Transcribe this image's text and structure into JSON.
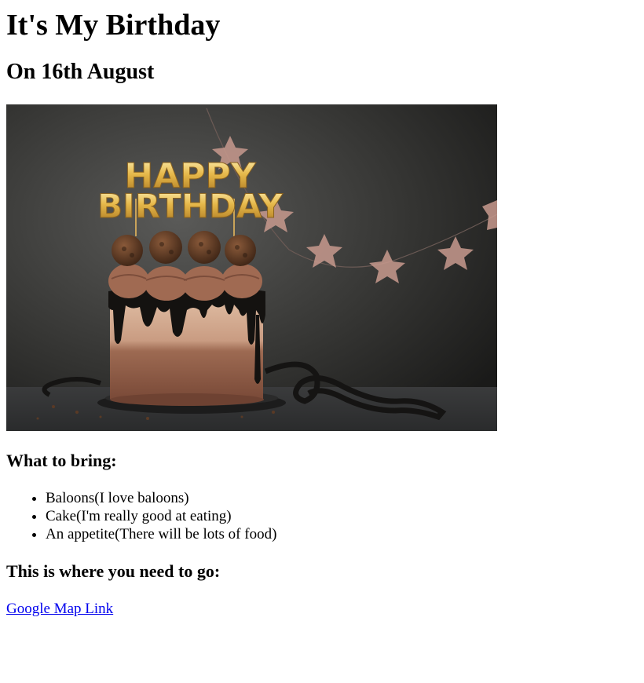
{
  "page": {
    "title": "It's My Birthday",
    "subtitle": "On 16th August"
  },
  "image": {
    "description_icon": "birthday-cake-photo",
    "topper_line1": "HAPPY",
    "topper_line2": "BIRTHDAY"
  },
  "bring": {
    "heading": "What to bring:",
    "items": [
      "Baloons(I love baloons)",
      "Cake(I'm really good at eating)",
      "An appetite(There will be lots of food)"
    ]
  },
  "location": {
    "heading": "This is where you need to go:",
    "link_text": "Google Map Link"
  },
  "colors": {
    "link": "#0000ee"
  }
}
